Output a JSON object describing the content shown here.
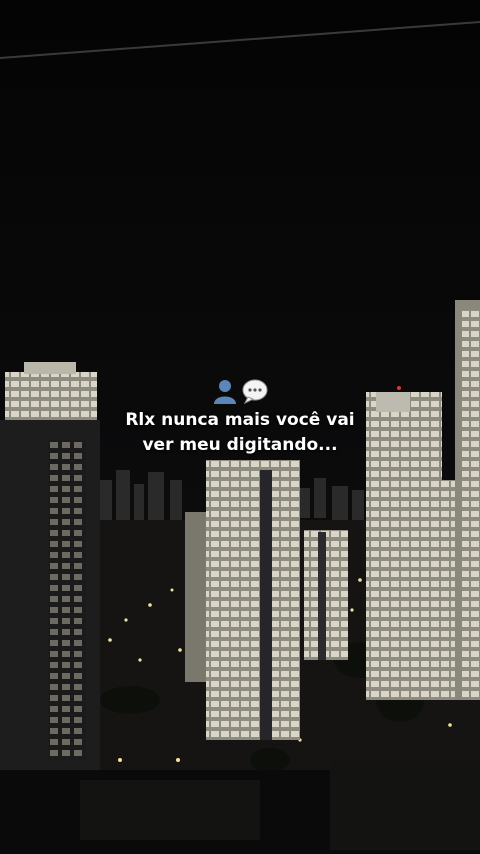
{
  "caption": {
    "icons": [
      "person-silhouette-icon",
      "speech-bubble-icon"
    ],
    "line1": "Rlx nunca mais você vai",
    "line2": "ver meu digitando..."
  },
  "colors": {
    "sky": "#050505",
    "window_light": "#e8e6d8",
    "street_light": "#f2e3a0"
  }
}
